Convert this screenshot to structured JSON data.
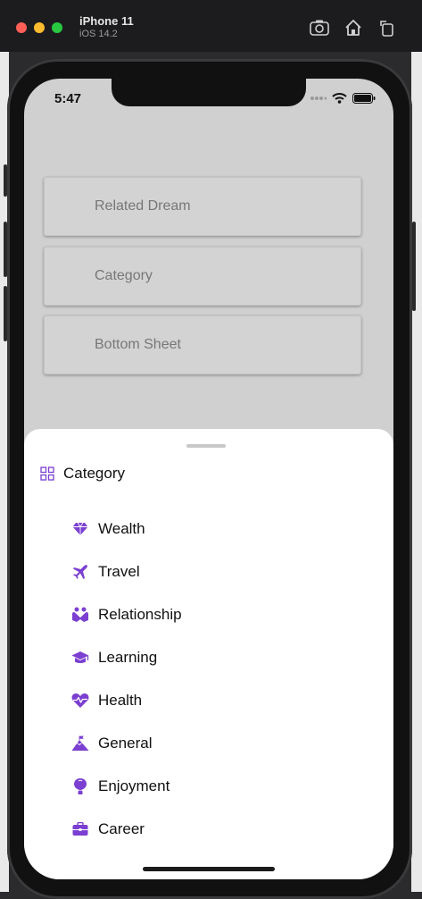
{
  "simulator": {
    "device_name": "iPhone 11",
    "os_version": "iOS 14.2"
  },
  "status_bar": {
    "time": "5:47"
  },
  "menu_buttons": [
    {
      "label": "Related Dream"
    },
    {
      "label": "Category"
    },
    {
      "label": "Bottom Sheet"
    }
  ],
  "sheet": {
    "title": "Category",
    "items": [
      {
        "label": "Wealth",
        "icon": "gem-icon"
      },
      {
        "label": "Travel",
        "icon": "plane-icon"
      },
      {
        "label": "Relationship",
        "icon": "relationship-icon"
      },
      {
        "label": "Learning",
        "icon": "graduation-cap-icon"
      },
      {
        "label": "Health",
        "icon": "heartbeat-icon"
      },
      {
        "label": "General",
        "icon": "mountain-flag-icon"
      },
      {
        "label": "Enjoyment",
        "icon": "balloon-icon"
      },
      {
        "label": "Career",
        "icon": "briefcase-icon"
      }
    ]
  },
  "colors": {
    "accent": "#7b3fd1",
    "sheet_bg": "#ffffff",
    "screen_bg": "#d0d0d1"
  }
}
